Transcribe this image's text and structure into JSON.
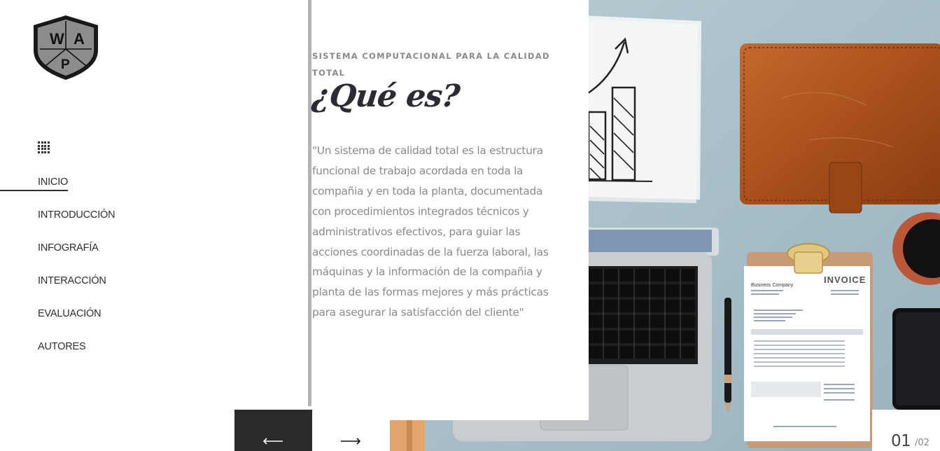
{
  "logo": {
    "letters": [
      "W",
      "A",
      "P"
    ],
    "colors": {
      "shield": "#8c8c8c",
      "outline": "#1a1a1a"
    }
  },
  "sidebar": {
    "menu_icon": "grid-icon",
    "items": [
      {
        "label": "INICIO",
        "active": true
      },
      {
        "label": "INTRODUCCIÓN",
        "active": false
      },
      {
        "label": "INFOGRAFÍA",
        "active": false
      },
      {
        "label": "INTERACCIÓN",
        "active": false
      },
      {
        "label": "EVALUACIÓN",
        "active": false
      },
      {
        "label": "AUTORES",
        "active": false
      }
    ]
  },
  "content": {
    "eyebrow": "SISTEMA COMPUTACIONAL PARA LA CALIDAD TOTAL",
    "title": "¿Qué es?",
    "body": "\"Un sistema de calidad total es la estructura funcional de trabajo acordada en toda la compañia y en toda la planta, documentada con procedimientos integrados técnicos y administrativos efectivos, para guiar las acciones coordinadas de la fuerza laboral, las máquinas y la información de la compañia y planta de las formas mejores y más prácticas para asegurar la satisfacción del cliente\""
  },
  "photo": {
    "invoice": {
      "heading": "INVOICE",
      "company": "Business Company"
    }
  },
  "controls": {
    "prev_icon": "arrow-left-icon",
    "next_icon": "arrow-right-icon",
    "current": "01",
    "total": "/02"
  },
  "colors": {
    "accent": "#2e2e2e",
    "text_muted": "#8a8a8a",
    "divider": "#b3b3b3",
    "photo_bg": "#a8c0c9"
  }
}
